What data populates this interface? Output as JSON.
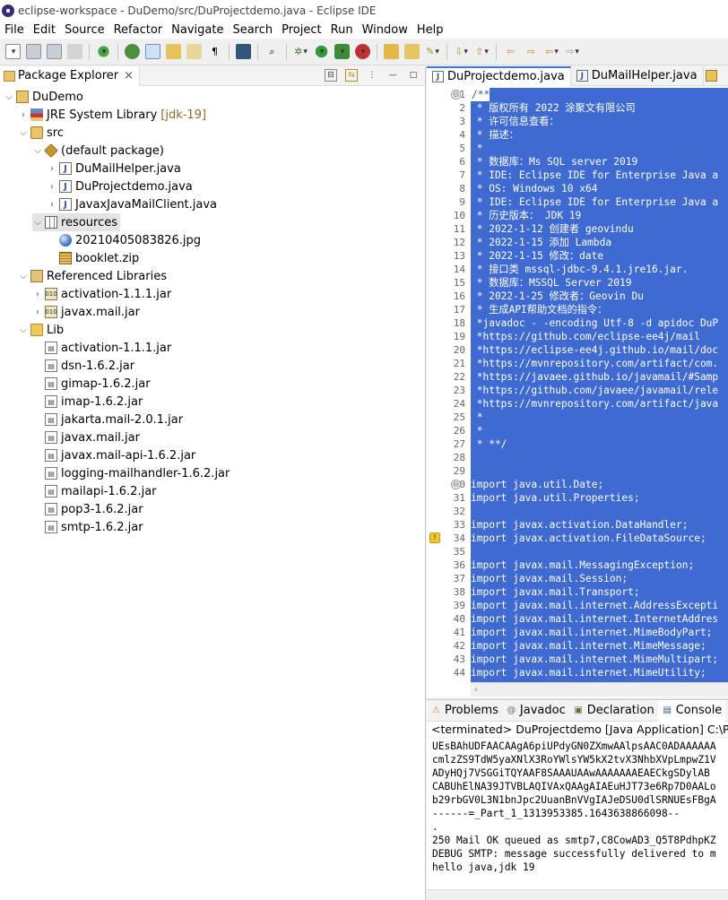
{
  "window": {
    "title": "eclipse-workspace - DuDemo/src/DuProjectdemo.java - Eclipse IDE"
  },
  "menu": [
    "File",
    "Edit",
    "Source",
    "Refactor",
    "Navigate",
    "Search",
    "Project",
    "Run",
    "Window",
    "Help"
  ],
  "package_explorer": {
    "tab_label": "Package Explorer",
    "close": "×",
    "tools": {
      "collapse": "⊟",
      "link": "⇆",
      "menu": "⋮",
      "minimize": "—",
      "maximize": "□"
    },
    "tree": [
      {
        "label": "DuDemo",
        "icon": "project-icon",
        "twisty": "⌵",
        "indent": 0
      },
      {
        "label": "JRE System Library",
        "extra": "[jdk-19]",
        "icon": "jre-library-icon",
        "twisty": "›",
        "indent": 1
      },
      {
        "label": "src",
        "icon": "source-folder-icon",
        "twisty": "⌵",
        "indent": 1
      },
      {
        "label": "(default package)",
        "icon": "package-icon",
        "twisty": "⌵",
        "indent": 2
      },
      {
        "label": "DuMailHelper.java",
        "icon": "java-file-icon",
        "twisty": "›",
        "indent": 3
      },
      {
        "label": "DuProjectdemo.java",
        "icon": "java-file-icon",
        "twisty": "›",
        "indent": 3
      },
      {
        "label": "JavaxJavaMailClient.java",
        "icon": "java-file-icon",
        "twisty": "›",
        "indent": 3
      },
      {
        "label": "resources",
        "icon": "resources-package-icon",
        "twisty": "⌵",
        "indent": 2,
        "selected": true
      },
      {
        "label": "20210405083826.jpg",
        "icon": "image-file-icon",
        "twisty": "",
        "indent": 3
      },
      {
        "label": "booklet.zip",
        "icon": "zip-file-icon",
        "twisty": "",
        "indent": 3
      },
      {
        "label": "Referenced Libraries",
        "icon": "referenced-libraries-icon",
        "twisty": "⌵",
        "indent": 1
      },
      {
        "label": "activation-1.1.1.jar",
        "icon": "jar-icon",
        "twisty": "›",
        "indent": 2
      },
      {
        "label": "javax.mail.jar",
        "icon": "jar-icon",
        "twisty": "›",
        "indent": 2
      },
      {
        "label": "Lib",
        "icon": "folder-icon",
        "twisty": "⌵",
        "indent": 1
      },
      {
        "label": "activation-1.1.1.jar",
        "icon": "lib-jar-icon",
        "twisty": "",
        "indent": 2
      },
      {
        "label": "dsn-1.6.2.jar",
        "icon": "lib-jar-icon",
        "twisty": "",
        "indent": 2
      },
      {
        "label": "gimap-1.6.2.jar",
        "icon": "lib-jar-icon",
        "twisty": "",
        "indent": 2
      },
      {
        "label": "imap-1.6.2.jar",
        "icon": "lib-jar-icon",
        "twisty": "",
        "indent": 2
      },
      {
        "label": "jakarta.mail-2.0.1.jar",
        "icon": "lib-jar-icon",
        "twisty": "",
        "indent": 2
      },
      {
        "label": "javax.mail.jar",
        "icon": "lib-jar-icon",
        "twisty": "",
        "indent": 2
      },
      {
        "label": "javax.mail-api-1.6.2.jar",
        "icon": "lib-jar-icon",
        "twisty": "",
        "indent": 2
      },
      {
        "label": "logging-mailhandler-1.6.2.jar",
        "icon": "lib-jar-icon",
        "twisty": "",
        "indent": 2
      },
      {
        "label": "mailapi-1.6.2.jar",
        "icon": "lib-jar-icon",
        "twisty": "",
        "indent": 2
      },
      {
        "label": "pop3-1.6.2.jar",
        "icon": "lib-jar-icon",
        "twisty": "",
        "indent": 2
      },
      {
        "label": "smtp-1.6.2.jar",
        "icon": "lib-jar-icon",
        "twisty": "",
        "indent": 2
      }
    ]
  },
  "editor": {
    "tabs": [
      {
        "label": "DuProjectdemo.java",
        "active": true
      },
      {
        "label": "DuMailHelper.java",
        "active": false
      }
    ],
    "lines": [
      {
        "n": "1",
        "text": "/**",
        "fold": "⊖",
        "caret": true
      },
      {
        "n": "2",
        "text": " * 版权所有 2022 涂聚文有限公司"
      },
      {
        "n": "3",
        "text": " * 许可信息查看："
      },
      {
        "n": "4",
        "text": " * 描述："
      },
      {
        "n": "5",
        "text": " *"
      },
      {
        "n": "6",
        "text": " * 数据库：Ms SQL server 2019"
      },
      {
        "n": "7",
        "text": " * IDE: Eclipse IDE for Enterprise Java a"
      },
      {
        "n": "8",
        "text": " * OS: Windows 10 x64"
      },
      {
        "n": "9",
        "text": " * IDE: Eclipse IDE for Enterprise Java a"
      },
      {
        "n": "10",
        "text": " * 历史版本： JDK 19"
      },
      {
        "n": "11",
        "text": " * 2022-1-12 创建者 geovindu"
      },
      {
        "n": "12",
        "text": " * 2022-1-15 添加 Lambda"
      },
      {
        "n": "13",
        "text": " * 2022-1-15 修改：date"
      },
      {
        "n": "14",
        "text": " * 接口类 mssql-jdbc-9.4.1.jre16.jar."
      },
      {
        "n": "15",
        "text": " * 数据库：MSSQL Server 2019"
      },
      {
        "n": "16",
        "text": " * 2022-1-25 修改者：Geovin Du"
      },
      {
        "n": "17",
        "text": " * 生成API帮助文档的指令："
      },
      {
        "n": "18",
        "text": " *javadoc - -encoding Utf-8 -d apidoc DuP"
      },
      {
        "n": "19",
        "text": " *https://github.com/eclipse-ee4j/mail"
      },
      {
        "n": "20",
        "text": " *https://eclipse-ee4j.github.io/mail/doc"
      },
      {
        "n": "21",
        "text": " *https://mvnrepository.com/artifact/com."
      },
      {
        "n": "22",
        "text": " *https://javaee.github.io/javamail/#Samp"
      },
      {
        "n": "23",
        "text": " *https://github.com/javaee/javamail/rele"
      },
      {
        "n": "24",
        "text": " *https://mvnrepository.com/artifact/java"
      },
      {
        "n": "25",
        "text": " *"
      },
      {
        "n": "26",
        "text": " *"
      },
      {
        "n": "27",
        "text": " * **/"
      },
      {
        "n": "28",
        "text": ""
      },
      {
        "n": "29",
        "text": ""
      },
      {
        "n": "30",
        "text": "import java.util.Date;",
        "fold": "⊖"
      },
      {
        "n": "31",
        "text": "import java.util.Properties;"
      },
      {
        "n": "32",
        "text": ""
      },
      {
        "n": "33",
        "text": "import javax.activation.DataHandler;"
      },
      {
        "n": "34",
        "text": "import javax.activation.FileDataSource;",
        "warn": true
      },
      {
        "n": "35",
        "text": ""
      },
      {
        "n": "36",
        "text": "import javax.mail.MessagingException;"
      },
      {
        "n": "37",
        "text": "import javax.mail.Session;"
      },
      {
        "n": "38",
        "text": "import javax.mail.Transport;"
      },
      {
        "n": "39",
        "text": "import javax.mail.internet.AddressExcepti"
      },
      {
        "n": "40",
        "text": "import javax.mail.internet.InternetAddres"
      },
      {
        "n": "41",
        "text": "import javax.mail.internet.MimeBodyPart;"
      },
      {
        "n": "42",
        "text": "import javax.mail.internet.MimeMessage;"
      },
      {
        "n": "43",
        "text": "import javax.mail.internet.MimeMultipart;"
      },
      {
        "n": "44",
        "text": "import javax.mail.internet.MimeUtility;"
      }
    ]
  },
  "bottom_panel": {
    "tabs": [
      {
        "label": "Problems",
        "icon": "problems-icon",
        "glyph": "⚠"
      },
      {
        "label": "Javadoc",
        "icon": "javadoc-icon",
        "glyph": "@"
      },
      {
        "label": "Declaration",
        "icon": "declaration-icon",
        "glyph": "▣"
      },
      {
        "label": "Console",
        "icon": "console-icon",
        "glyph": "▤"
      }
    ],
    "status": "<terminated> DuProjectdemo [Java Application] C:\\Progr",
    "output": [
      "UEsBAhUDFAACAAgA6piUPdyGN0ZXmwAAlpsAAC0ADAAAAAA",
      "cmlzZS9TdW5yaXNlX3RoYWlsYW5kX2tvX3NhbXVpLmpwZ1V",
      "ADyHQj7VSGGiTQYAAF8SAAAUAAwAAAAAAAEAECkgSDylAB",
      "CABUhElNA39JTVBLAQIVAxQAAgAIAEuHJT73e6Rp7D0AALo",
      "b29rbGV0L3N1bnJpc2UuanBnVVgIAJeDSU0dlSRNUEsFBgA",
      "------=_Part_1_1313953385.1643638866098--",
      ".",
      "250 Mail OK queued as smtp7,C8CowAD3_Q5T8PdhpKZ",
      "DEBUG SMTP: message successfully delivered to m",
      "hello java,jdk 19"
    ]
  }
}
